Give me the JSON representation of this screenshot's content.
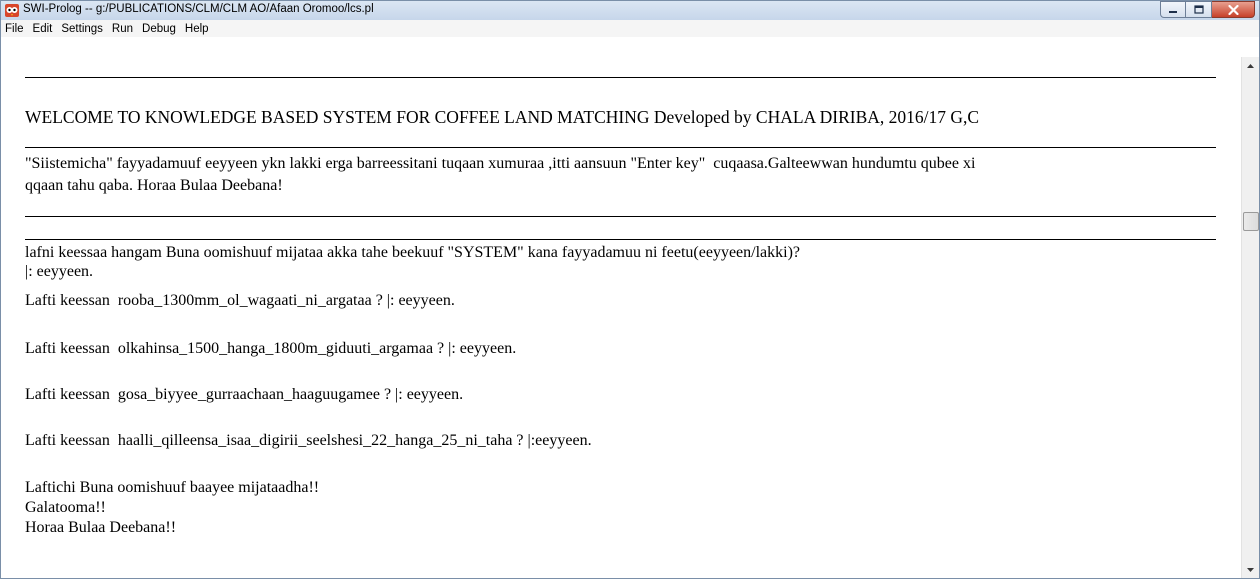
{
  "window": {
    "title": "SWI-Prolog -- g:/PUBLICATIONS/CLM/CLM AO/Afaan Oromoo/lcs.pl"
  },
  "menu": [
    "File",
    "Edit",
    "Settings",
    "Run",
    "Debug",
    "Help"
  ],
  "console": {
    "welcome": "WELCOME TO KNOWLEDGE BASED SYSTEM FOR COFFEE LAND MATCHING Developed by CHALA DIRIBA, 2016/17 G,C",
    "instructions_line1": "\"Siistemicha\" fayyadamuuf eeyyeen ykn lakki erga barreessitani tuqaan xumuraa ,itti aansuun \"Enter key\"  cuqaasa.Galteewwan hundumtu qubee xi",
    "instructions_line2": "qqaan tahu qaba. Horaa Bulaa Deebana!",
    "question_intro": "lafni keessaa hangam Buna oomishuuf mijataa akka tahe beekuuf \"SYSTEM\" kana fayyadamuu ni feetu(eeyyeen/lakki)?",
    "answer_intro": "|: eeyyeen.",
    "q1": "Lafti keessan  rooba_1300mm_ol_wagaati_ni_argataa ? |: eeyyeen.",
    "q2": "Lafti keessan  olkahinsa_1500_hanga_1800m_giduuti_argamaa ? |: eeyyeen.",
    "q3": "Lafti keessan  gosa_biyyee_gurraachaan_haaguugamee ? |: eeyyeen.",
    "q4": "Lafti keessan  haalli_qilleensa_isaa_digirii_seelshesi_22_hanga_25_ni_taha ? |:eeyyeen.",
    "result": "Laftichi Buna oomishuuf baayee mijataadha!!",
    "thanks": "Galatooma!!",
    "farewell": "Horaa Bulaa Deebana!!"
  },
  "icons": {
    "app": "swi-prolog-owl-icon",
    "minimize": "minimize-icon",
    "maximize": "maximize-icon",
    "close": "close-icon",
    "scroll_up": "arrow-up-icon",
    "scroll_down": "arrow-down-icon"
  },
  "colors": {
    "titlebar": "#c6d6ea",
    "close_button": "#c7412a",
    "text": "#000000"
  }
}
